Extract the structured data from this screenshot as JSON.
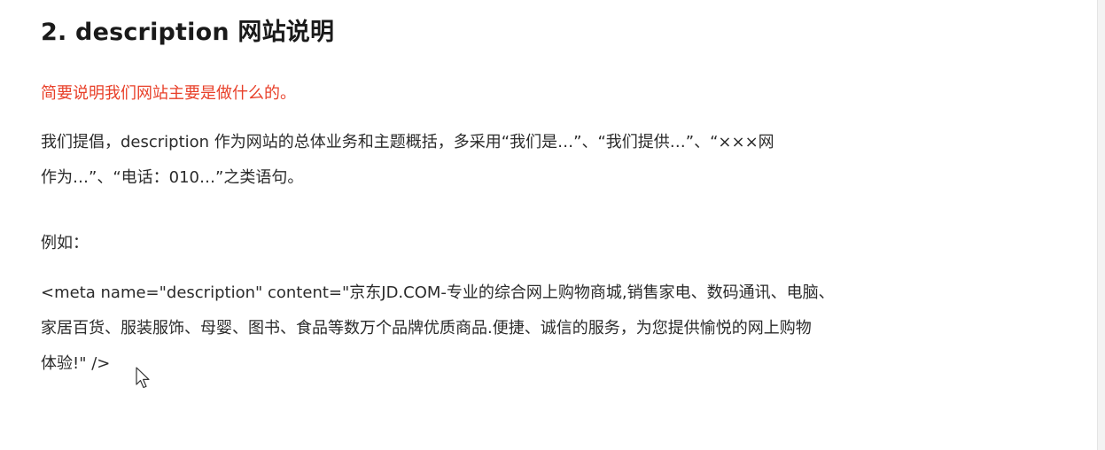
{
  "section": {
    "title": "2. description 网站说明",
    "highlight": "简要说明我们网站主要是做什么的。"
  },
  "paragraphs": {
    "intro_line1": "我们提倡，description 作为网站的总体业务和主题概括，多采用“我们是…”、“我们提供…”、“×××网",
    "intro_line2": "作为…”、“电话：010…”之类语句。",
    "example_label": "例如：",
    "example_line1": "<meta name=\"description\" content=\"京东JD.COM-专业的综合网上购物商城,销售家电、数码通讯、电脑、",
    "example_line2": "家居百货、服装服饰、母婴、图书、食品等数万个品牌优质商品.便捷、诚信的服务，为您提供愉悦的网上购物",
    "example_line3": "体验!\" />"
  },
  "colors": {
    "highlight": "#e8402a",
    "text": "#2b2b2b",
    "title": "#1a1a1a"
  },
  "icons": {
    "cursor": "mouse-pointer-icon"
  }
}
